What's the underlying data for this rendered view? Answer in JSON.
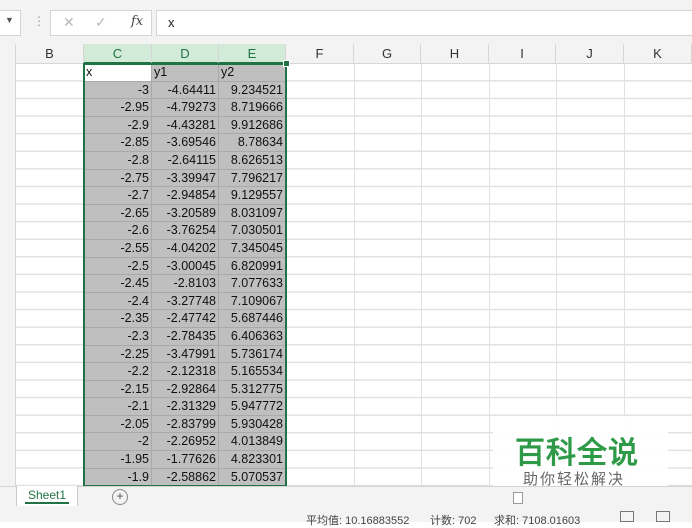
{
  "formula_bar": {
    "name_box_value": "",
    "formula": "x"
  },
  "columns": [
    "B",
    "C",
    "D",
    "E",
    "F",
    "G",
    "H",
    "I",
    "J",
    "K"
  ],
  "table": {
    "headers": [
      "x",
      "y1",
      "y2"
    ],
    "rows": [
      [
        "-3",
        "-4.64411",
        "9.234521"
      ],
      [
        "-2.95",
        "-4.79273",
        "8.719666"
      ],
      [
        "-2.9",
        "-4.43281",
        "9.912686"
      ],
      [
        "-2.85",
        "-3.69546",
        "8.78634"
      ],
      [
        "-2.8",
        "-2.64115",
        "8.626513"
      ],
      [
        "-2.75",
        "-3.39947",
        "7.796217"
      ],
      [
        "-2.7",
        "-2.94854",
        "9.129557"
      ],
      [
        "-2.65",
        "-3.20589",
        "8.031097"
      ],
      [
        "-2.6",
        "-3.76254",
        "7.030501"
      ],
      [
        "-2.55",
        "-4.04202",
        "7.345045"
      ],
      [
        "-2.5",
        "-3.00045",
        "6.820991"
      ],
      [
        "-2.45",
        "-2.8103",
        "7.077633"
      ],
      [
        "-2.4",
        "-3.27748",
        "7.109067"
      ],
      [
        "-2.35",
        "-2.47742",
        "5.687446"
      ],
      [
        "-2.3",
        "-2.78435",
        "6.406363"
      ],
      [
        "-2.25",
        "-3.47991",
        "5.736174"
      ],
      [
        "-2.2",
        "-2.12318",
        "5.165534"
      ],
      [
        "-2.15",
        "-2.92864",
        "5.312775"
      ],
      [
        "-2.1",
        "-2.31329",
        "5.947772"
      ],
      [
        "-2.05",
        "-2.83799",
        "5.930428"
      ],
      [
        "-2",
        "-2.26952",
        "4.013849"
      ],
      [
        "-1.95",
        "-1.77626",
        "4.823301"
      ],
      [
        "-1.9",
        "-2.58862",
        "5.070537"
      ]
    ]
  },
  "sheet_tab": "Sheet1",
  "add_sheet_icon": "plus-circle-icon",
  "status_bar": {
    "average": "平均值: 10.16883552",
    "count": "计数: 702",
    "sum": "求和: 7108.01603"
  },
  "watermark": {
    "title": "百科全说",
    "subtitle": "助你轻松解决"
  },
  "colors": {
    "accent": "#217346",
    "selection_fill": "#bfbfbf",
    "watermark_green": "#2e9a48"
  }
}
